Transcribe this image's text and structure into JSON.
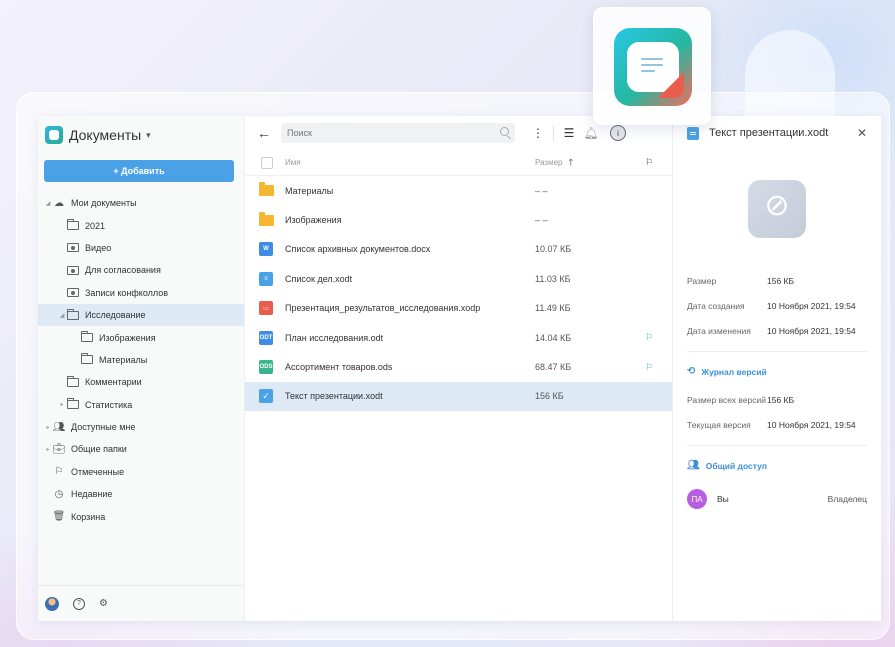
{
  "sidebar": {
    "title": "Документы",
    "add_label": "+ Добавить",
    "items": [
      {
        "label": "Мои документы",
        "level": 0,
        "arrow": "◢",
        "icon": "cloud-icon"
      },
      {
        "label": "2021",
        "level": 1,
        "arrow": "",
        "icon": "folder-icon"
      },
      {
        "label": "Видео",
        "level": 1,
        "arrow": "",
        "icon": "shared-folder-icon"
      },
      {
        "label": "Для согласования",
        "level": 1,
        "arrow": "",
        "icon": "shared-folder-icon"
      },
      {
        "label": "Записи конфколлов",
        "level": 1,
        "arrow": "",
        "icon": "shared-folder-icon"
      },
      {
        "label": "Исследование",
        "level": 1,
        "arrow": "◢",
        "icon": "folder-icon",
        "active": true
      },
      {
        "label": "Изображения",
        "level": 2,
        "arrow": "",
        "icon": "folder-icon"
      },
      {
        "label": "Материалы",
        "level": 2,
        "arrow": "",
        "icon": "folder-icon"
      },
      {
        "label": "Комментарии",
        "level": 1,
        "arrow": "",
        "icon": "folder-icon"
      },
      {
        "label": "Статистика",
        "level": 1,
        "arrow": "▸",
        "icon": "folder-icon"
      },
      {
        "label": "Доступные мне",
        "level": 0,
        "arrow": "▸",
        "icon": "people-icon"
      },
      {
        "label": "Общие папки",
        "level": 0,
        "arrow": "▸",
        "icon": "briefcase-icon"
      },
      {
        "label": "Отмеченные",
        "level": 0,
        "arrow": "",
        "icon": "flag-icon"
      },
      {
        "label": "Недавние",
        "level": 0,
        "arrow": "",
        "icon": "clock-icon"
      },
      {
        "label": "Корзина",
        "level": 0,
        "arrow": "",
        "icon": "trash-icon"
      }
    ]
  },
  "search": {
    "placeholder": "Поиск"
  },
  "table": {
    "col_name": "Имя",
    "col_size": "Размер",
    "rows": [
      {
        "name": "Материалы",
        "size": "– –",
        "type": "folder",
        "flag": false
      },
      {
        "name": "Изображения",
        "size": "– –",
        "type": "folder",
        "flag": false
      },
      {
        "name": "Список архивных документов.docx",
        "size": "10.07 КБ",
        "type": "docx",
        "flag": false
      },
      {
        "name": "Список дел.xodt",
        "size": "11.03 КБ",
        "type": "xodt",
        "flag": false
      },
      {
        "name": "Презентация_результатов_исследования.xodp",
        "size": "11.49 КБ",
        "type": "xodp",
        "flag": false
      },
      {
        "name": "План исследования.odt",
        "size": "14.04 КБ",
        "type": "odt",
        "flag": true
      },
      {
        "name": "Ассортимент товаров.ods",
        "size": "68.47 КБ",
        "type": "ods",
        "flag": true
      },
      {
        "name": "Текст презентации.xodt",
        "size": "156 КБ",
        "type": "selected",
        "flag": false
      }
    ]
  },
  "panel": {
    "title": "Текст презентации.xodt",
    "size_k": "Размер",
    "size_v": "156 КБ",
    "created_k": "Дата создания",
    "created_v": "10 Ноября 2021, 19:54",
    "modified_k": "Дата изменения",
    "modified_v": "10 Ноября 2021, 19:54",
    "history_link": "Журнал версий",
    "all_versions_k": "Размер всех версий",
    "all_versions_v": "156 КБ",
    "current_version_k": "Текущая версия",
    "current_version_v": "10 Ноября 2021, 19:54",
    "share_link": "Общий доступ",
    "owner_initials": "ПА",
    "owner_name": "Вы",
    "owner_role": "Владелец"
  },
  "colors": {
    "accent": "#4aa1e6",
    "selected_row": "#dde9f5",
    "folder": "#f5b731"
  }
}
